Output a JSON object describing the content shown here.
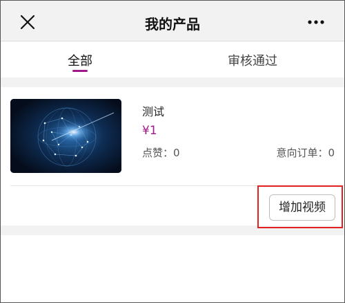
{
  "header": {
    "title": "我的产品",
    "close_icon": "close-icon",
    "more_icon": "more-dots-icon"
  },
  "tabs": [
    {
      "label": "全部",
      "active": true
    },
    {
      "label": "审核通过",
      "active": false
    }
  ],
  "colors": {
    "accent": "#a0178a",
    "highlight_border": "#e32020"
  },
  "product": {
    "name": "测试",
    "price": "¥1",
    "likes": "点赞：0",
    "orders": "意向订单：0",
    "image": "network-globe-image"
  },
  "actions": {
    "add_video_label": "增加视频"
  }
}
